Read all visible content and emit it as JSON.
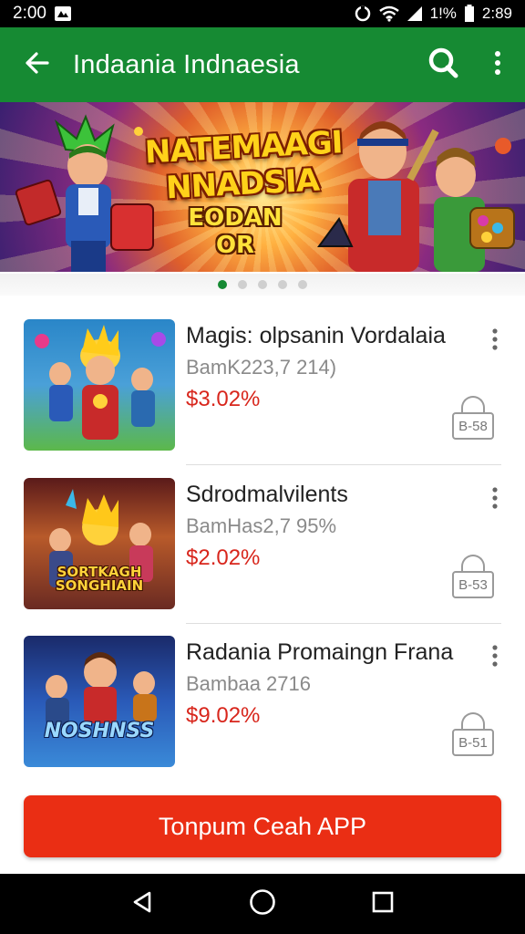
{
  "status_bar": {
    "time": "2:00",
    "battery_text": "1!%",
    "clock_right": "2:89"
  },
  "app_bar": {
    "title": "Indaania Indnaesia"
  },
  "banner": {
    "title": "NATEMAAGI NNADSIA",
    "subtitle": "EODAN OR"
  },
  "carousel": {
    "total": 5,
    "active_index": 0
  },
  "items": [
    {
      "title": "Magis: olpsanin Vordalaia",
      "subtitle": "BamK223,7 214)",
      "price": "$3.02%",
      "lock_label": "B-58",
      "thumb_colors": [
        "#2a86c8",
        "#5cb84a"
      ]
    },
    {
      "title": "Sdrodmalvilents",
      "subtitle": "BamHas2,7 95%",
      "price": "$2.02%",
      "lock_label": "B-53",
      "thumb_caption": "SORTKAGH SONGHIAIN",
      "thumb_colors": [
        "#6a2a22",
        "#d89a3a"
      ]
    },
    {
      "title": "Radania Promaingn Frana",
      "subtitle": "Bambaa 2716",
      "price": "$9.02%",
      "lock_label": "B-51",
      "thumb_caption": "NOSHNSS",
      "thumb_colors": [
        "#1a2a6a",
        "#3a8ad8"
      ]
    }
  ],
  "cta": {
    "label": "Tonpum Ceah APP"
  },
  "colors": {
    "app_bar": "#168a33",
    "cta": "#ea2e14",
    "price": "#d8261c"
  }
}
